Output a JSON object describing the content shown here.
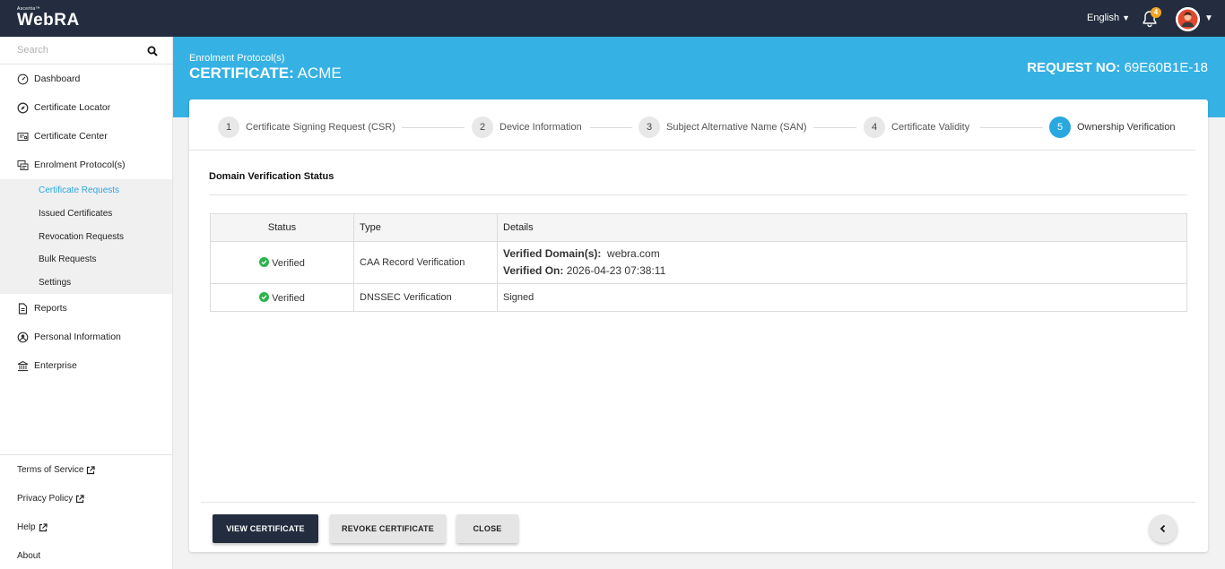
{
  "topbar": {
    "brand_small": "Ascertia™",
    "brand": "WebRA",
    "language": "English",
    "notification_count": "4"
  },
  "sidebar": {
    "search_placeholder": "Search",
    "items": [
      {
        "label": "Dashboard",
        "icon": "dashboard-icon"
      },
      {
        "label": "Certificate Locator",
        "icon": "compass-icon"
      },
      {
        "label": "Certificate Center",
        "icon": "certificate-icon"
      },
      {
        "label": "Enrolment Protocol(s)",
        "icon": "protocol-icon"
      }
    ],
    "sub_items": [
      {
        "label": "Certificate Requests",
        "active": true
      },
      {
        "label": "Issued Certificates"
      },
      {
        "label": "Revocation Requests"
      },
      {
        "label": "Bulk Requests"
      },
      {
        "label": "Settings"
      }
    ],
    "lower_items": [
      {
        "label": "Reports",
        "icon": "document-icon"
      },
      {
        "label": "Personal Information",
        "icon": "user-circle-icon"
      },
      {
        "label": "Enterprise",
        "icon": "bank-icon"
      }
    ],
    "links": [
      {
        "label": "Terms of Service",
        "external": true
      },
      {
        "label": "Privacy Policy",
        "external": true
      },
      {
        "label": "Help",
        "external": true
      },
      {
        "label": "About",
        "external": false
      }
    ]
  },
  "header": {
    "breadcrumb": "Enrolment Protocol(s)",
    "cert_label": "CERTIFICATE:",
    "cert_value": "ACME",
    "req_label": "REQUEST NO:",
    "req_value": "69E60B1E-18"
  },
  "steps": [
    {
      "num": "1",
      "label": "Certificate Signing Request (CSR)"
    },
    {
      "num": "2",
      "label": "Device Information"
    },
    {
      "num": "3",
      "label": "Subject Alternative Name (SAN)"
    },
    {
      "num": "4",
      "label": "Certificate Validity"
    },
    {
      "num": "5",
      "label": "Ownership Verification",
      "active": true
    }
  ],
  "section_title": "Domain Verification Status",
  "table": {
    "headers": [
      "Status",
      "Type",
      "Details"
    ],
    "rows": [
      {
        "status": "Verified",
        "type": "CAA Record Verification",
        "details_label1": "Verified Domain(s):",
        "details_value1": "webra.com",
        "details_label2": "Verified On:",
        "details_value2": "2026-04-23 07:38:11"
      },
      {
        "status": "Verified",
        "type": "DNSSEC Verification",
        "details": "Signed"
      }
    ]
  },
  "buttons": {
    "view": "View Certificate",
    "revoke": "Revoke Certificate",
    "close": "Close"
  },
  "colors": {
    "topbar": "#232d3f",
    "accent": "#35b1e4",
    "active_step": "#29a8e0",
    "verified": "#2db34a"
  }
}
